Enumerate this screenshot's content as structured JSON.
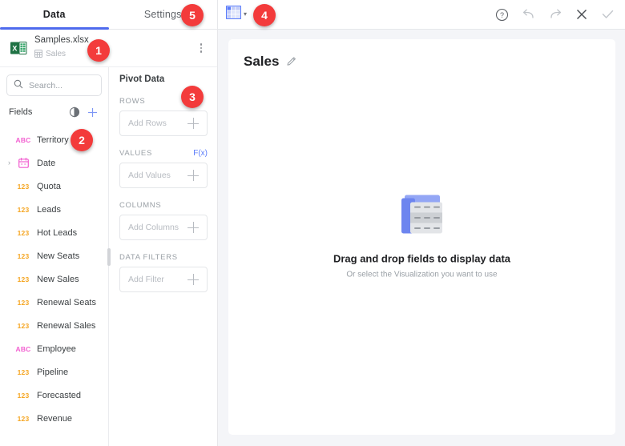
{
  "tabs": [
    {
      "label": "Data",
      "active": true
    },
    {
      "label": "Settings",
      "active": false
    }
  ],
  "datasource": {
    "file_name": "Samples.xlsx",
    "sheet_name": "Sales",
    "file_icon": "excel-icon",
    "sheet_icon": "table-icon",
    "menu_icon": "kebab-menu-icon"
  },
  "search": {
    "placeholder": "Search...",
    "value": "",
    "icon": "search-icon"
  },
  "fields_panel": {
    "title": "Fields",
    "contrast_icon": "half-circle-icon",
    "add_icon": "plus-icon",
    "fields": [
      {
        "type": "ABC",
        "name": "Territory",
        "expandable": false
      },
      {
        "type": "DATE",
        "name": "Date",
        "expandable": true
      },
      {
        "type": "123",
        "name": "Quota",
        "expandable": false
      },
      {
        "type": "123",
        "name": "Leads",
        "expandable": false
      },
      {
        "type": "123",
        "name": "Hot Leads",
        "expandable": false
      },
      {
        "type": "123",
        "name": "New Seats",
        "expandable": false
      },
      {
        "type": "123",
        "name": "New Sales",
        "expandable": false
      },
      {
        "type": "123",
        "name": "Renewal Seats",
        "expandable": false
      },
      {
        "type": "123",
        "name": "Renewal Sales",
        "expandable": false
      },
      {
        "type": "ABC",
        "name": "Employee",
        "expandable": false
      },
      {
        "type": "123",
        "name": "Pipeline",
        "expandable": false
      },
      {
        "type": "123",
        "name": "Forecasted",
        "expandable": false
      },
      {
        "type": "123",
        "name": "Revenue",
        "expandable": false
      }
    ]
  },
  "pivot_panel": {
    "title": "Pivot Data",
    "sections": [
      {
        "label": "ROWS",
        "placeholder": "Add Rows",
        "action": null
      },
      {
        "label": "VALUES",
        "placeholder": "Add Values",
        "action": "F(x)"
      },
      {
        "label": "COLUMNS",
        "placeholder": "Add Columns",
        "action": null
      },
      {
        "label": "DATA FILTERS",
        "placeholder": "Add Filter",
        "action": null
      }
    ]
  },
  "toolbar": {
    "viz_icon": "table-visualization-icon",
    "viz_chevron": "chevron-down-icon",
    "actions": [
      {
        "name": "help-icon",
        "glyph": "?"
      },
      {
        "name": "undo-icon",
        "glyph": "undo"
      },
      {
        "name": "redo-icon",
        "glyph": "redo"
      },
      {
        "name": "close-icon",
        "glyph": "close"
      },
      {
        "name": "confirm-icon",
        "glyph": "check"
      }
    ]
  },
  "canvas": {
    "title": "Sales",
    "edit_icon": "pencil-icon",
    "empty_state": {
      "icon": "table-placeholder-icon",
      "title": "Drag and drop fields to display data",
      "subtitle": "Or select the Visualization you want to use"
    }
  },
  "badges": [
    {
      "id": "badge1",
      "label": "1"
    },
    {
      "id": "badge2",
      "label": "2"
    },
    {
      "id": "badge3",
      "label": "3"
    },
    {
      "id": "badge4",
      "label": "4"
    },
    {
      "id": "badge5",
      "label": "5"
    }
  ],
  "colors": {
    "accent_blue": "#4f6bed",
    "badge_red": "#f33b3b",
    "text_type": "#f5a623",
    "abc_type": "#f25fd0",
    "excel_green": "#1f7244"
  }
}
